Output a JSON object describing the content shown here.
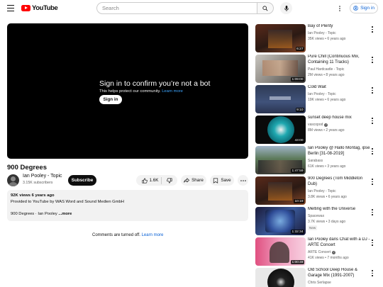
{
  "header": {
    "logo_text": "YouTube",
    "search_placeholder": "Search",
    "signin_label": "Sign in"
  },
  "player": {
    "title": "Sign in to confirm you’re not a bot",
    "subtitle": "This helps protect our community.",
    "learn_more": "Learn more",
    "signin_label": "Sign in"
  },
  "video": {
    "title": "900 Degrees",
    "channel": "Ian Pooley - Topic",
    "subscribers": "3.15K subscribers",
    "subscribe_label": "Subscribe",
    "likes": "1.6K",
    "share_label": "Share",
    "save_label": "Save"
  },
  "description": {
    "meta": "92K views  6 years ago",
    "line1": "Provided to YouTube by WAS Word and Sound Medien GmbH",
    "tags": "900 Degrees · Ian Pooley",
    "more_label": "...more"
  },
  "comments": {
    "text": "Comments are turned off.",
    "learn_more": "Learn more"
  },
  "sidebar": {
    "items": [
      {
        "title": "Bay of Plenty",
        "channel": "Ian Pooley - Topic",
        "meta": "35K views • 6 years ago",
        "duration": "6:27",
        "verified": false,
        "badge": ""
      },
      {
        "title": "Pure Chill (Continuous Mix, Containing 11 Tracks)",
        "channel": "Paul Hardcastle - Topic",
        "meta": "2M views • 8 years ago",
        "duration": "1:09:00",
        "verified": false,
        "badge": ""
      },
      {
        "title": "Cold Wait",
        "channel": "Ian Pooley - Topic",
        "meta": "19K views • 6 years ago",
        "duration": "9:10",
        "verified": false,
        "badge": ""
      },
      {
        "title": "sunset deep house mix",
        "channel": "vascopod",
        "meta": "8M views • 2 years ago",
        "duration": "43:00",
        "verified": true,
        "badge": ""
      },
      {
        "title": "Ian Pooley @ Hallo Montag, ipse Berlin [31-08-2019]",
        "channel": "Sarabass",
        "meta": "61K views • 3 years ago",
        "duration": "1:47:59",
        "verified": false,
        "badge": ""
      },
      {
        "title": "900 Degrees (Tom Middleton Dub)",
        "channel": "Ian Pooley - Topic",
        "meta": "3.8K views • 6 years ago",
        "duration": "10:19",
        "verified": false,
        "badge": ""
      },
      {
        "title": "Melting with the Universe",
        "channel": "Spacewax",
        "meta": "3.7K views • 3 days ago",
        "duration": "1:32:34",
        "verified": false,
        "badge": "New"
      },
      {
        "title": "Ian Pooley dans Chat with a DJ - ARTE Concert",
        "channel": "ARTE Concert",
        "meta": "41K views • 7 months ago",
        "duration": "1:00:49",
        "verified": true,
        "badge": ""
      },
      {
        "title": "Old School Deep House & Garage Mix (1991-2007)",
        "channel": "Chris Serlapse",
        "meta": "",
        "duration": "",
        "verified": false,
        "badge": ""
      }
    ]
  },
  "colors": {
    "brand_red": "#ff0000",
    "link_blue": "#065fd4",
    "player_bg": "#000000"
  }
}
